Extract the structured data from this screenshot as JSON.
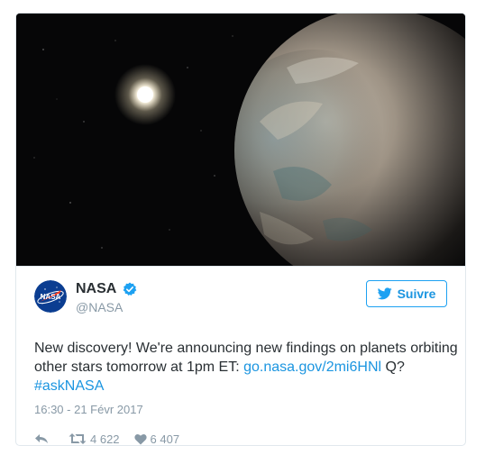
{
  "tweet": {
    "author_name": "NASA",
    "author_handle": "@NASA",
    "follow_label": "Suivre",
    "text_before_link": "New discovery! We're announcing new findings on planets orbiting other stars tomorrow at 1pm ET: ",
    "link_text": "go.nasa.gov/2mi6HNl",
    "text_between": " Q? ",
    "hashtag": "#askNASA",
    "timestamp": "16:30 - 21 Févr 2017",
    "retweet_count": "4 622",
    "like_count": "6 407"
  },
  "icons": {
    "verified": "verified-badge-icon",
    "follow": "twitter-bird-icon",
    "reply": "reply-icon",
    "retweet": "retweet-icon",
    "like": "heart-icon"
  },
  "colors": {
    "link": "#1b95e0",
    "muted": "#8899a6",
    "text": "#292f33",
    "border": "#e1e8ed"
  }
}
